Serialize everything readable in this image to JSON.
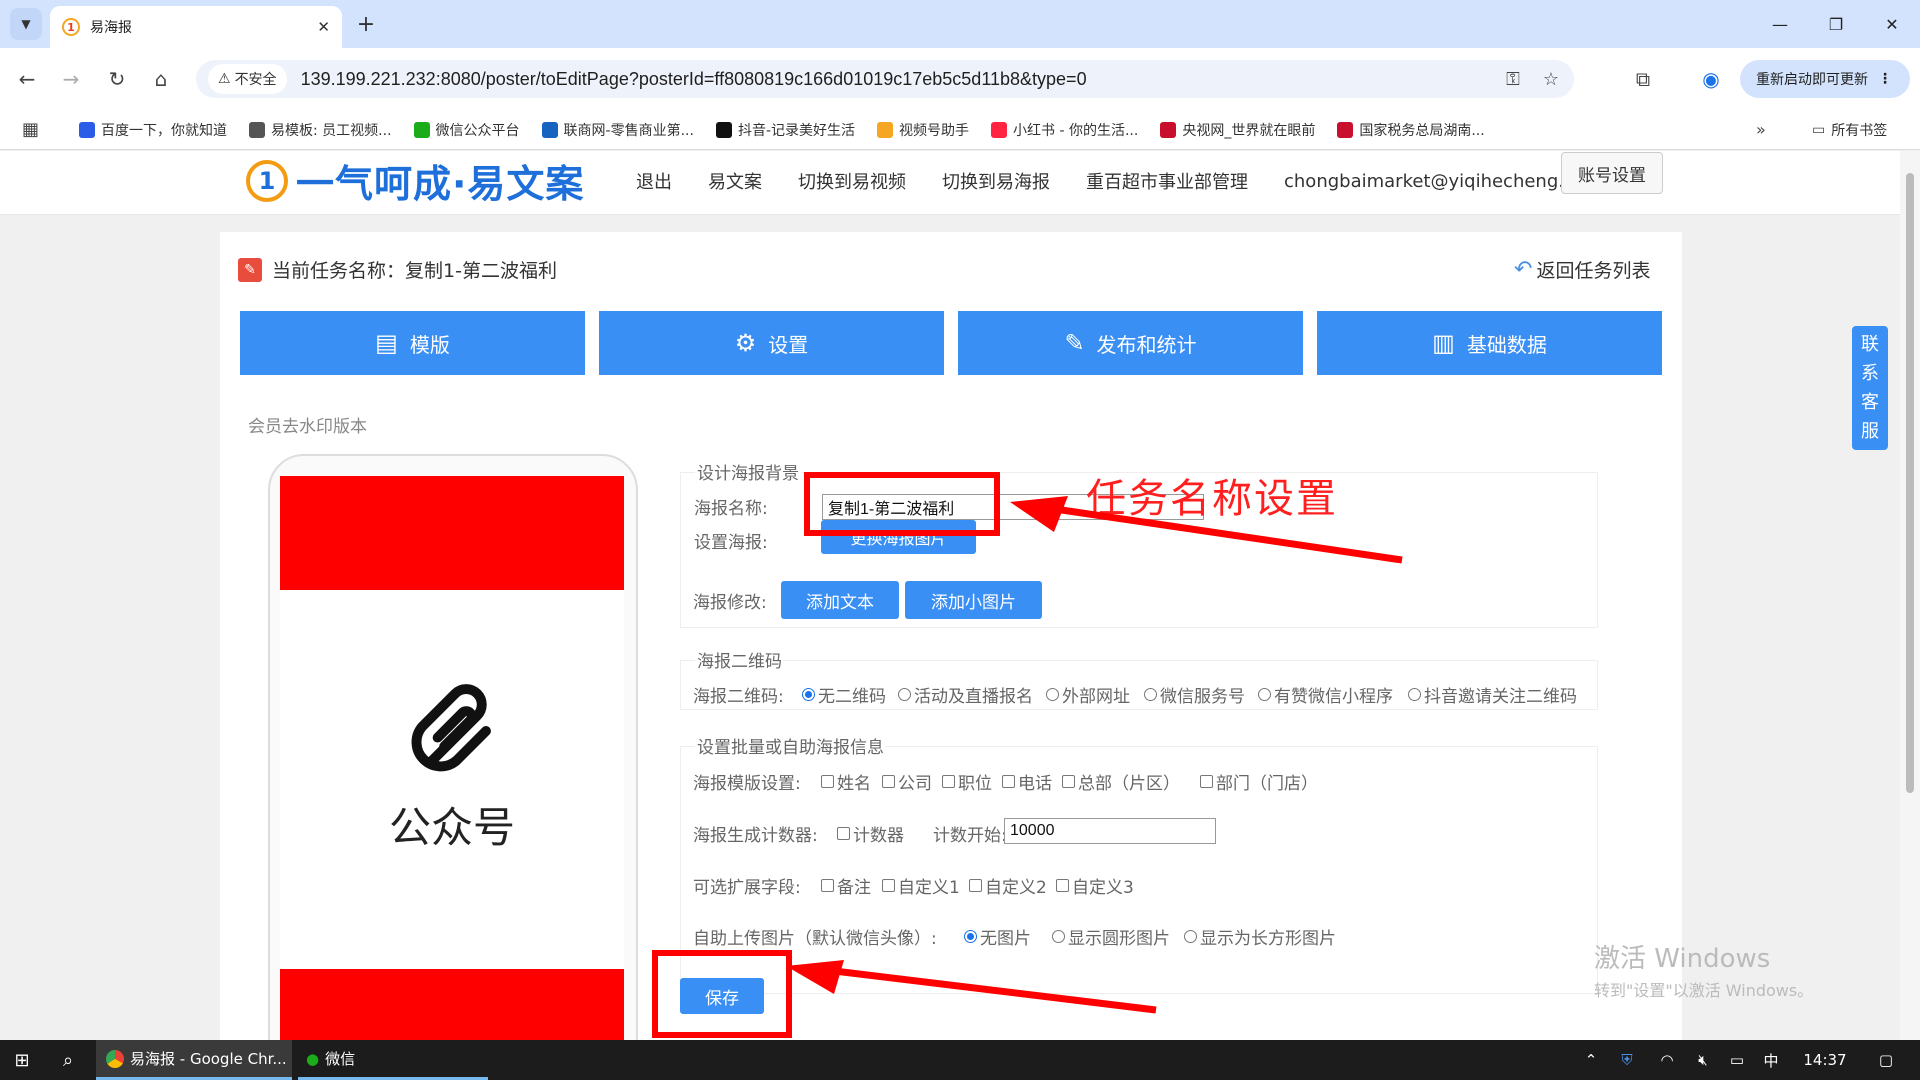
{
  "browser": {
    "tab_title": "易海报",
    "url": "139.199.221.232:8080/poster/toEditPage?posterId=ff8080819c166d01019c17eb5c5d11b8&type=0",
    "insecure_label": "不安全",
    "update_label": "重新启动即可更新",
    "bookmarks": [
      {
        "label": "百度一下，你就知道",
        "color": "#2b5ce8"
      },
      {
        "label": "易模板: 员工视频...",
        "color": "#555555"
      },
      {
        "label": "微信公众平台",
        "color": "#1aad19"
      },
      {
        "label": "联商网-零售商业第...",
        "color": "#1565c0"
      },
      {
        "label": "抖音-记录美好生活",
        "color": "#111111"
      },
      {
        "label": "视频号助手",
        "color": "#f5a623"
      },
      {
        "label": "小红书 - 你的生活...",
        "color": "#ff2442"
      },
      {
        "label": "央视网_世界就在眼前",
        "color": "#c8102e"
      },
      {
        "label": "国家税务总局湖南...",
        "color": "#c8102e"
      }
    ],
    "all_bookmarks_label": "所有书签"
  },
  "site": {
    "logo_text": "一气呵成·易文案",
    "nav": [
      "退出",
      "易文案",
      "切换到易视频",
      "切换到易海报",
      "重百超市事业部管理",
      "chongbaimarket@yiqihecheng.cc"
    ],
    "account_button": "账号设置"
  },
  "page": {
    "task_label": "当前任务名称：复制1-第二波福利",
    "back_label": "返回任务列表",
    "tabs": [
      {
        "label": "模版",
        "icon": "template-icon"
      },
      {
        "label": "设置",
        "icon": "gear-icon"
      },
      {
        "label": "发布和统计",
        "icon": "edit-icon"
      },
      {
        "label": "基础数据",
        "icon": "data-icon"
      }
    ],
    "member_note": "会员去水印版本",
    "preview_text": "公众号"
  },
  "form": {
    "bg_legend": "设计海报背景",
    "name_label": "海报名称:",
    "name_value": "复制1-第二波福利",
    "set_poster_label": "设置海报:",
    "change_image_btn": "更换海报图片",
    "modify_label": "海报修改:",
    "add_text_btn": "添加文本",
    "add_image_btn": "添加小图片",
    "qr_legend": "海报二维码",
    "qr_label": "海报二维码:",
    "qr_options": [
      "无二维码",
      "活动及直播报名",
      "外部网址",
      "微信服务号",
      "有赞微信小程序",
      "抖音邀请关注二维码"
    ],
    "qr_selected": 0,
    "batch_legend": "设置批量或自助海报信息",
    "template_label": "海报模版设置:",
    "template_options": [
      "姓名",
      "公司",
      "职位",
      "电话",
      "总部（片区）",
      "部门（门店）"
    ],
    "counter_label": "海报生成计数器:",
    "counter_option": "计数器",
    "counter_start_label": "计数开始:",
    "counter_start_value": "10000",
    "ext_label": "可选扩展字段:",
    "ext_options": [
      "备注",
      "自定义1",
      "自定义2",
      "自定义3"
    ],
    "upload_label": "自助上传图片（默认微信头像）:",
    "upload_options": [
      "无图片",
      "显示圆形图片",
      "显示为长方形图片"
    ],
    "upload_selected": 0,
    "save_btn": "保存"
  },
  "annotation": {
    "text": "任务名称设置"
  },
  "contact": {
    "chars": [
      "联",
      "系",
      "客",
      "服"
    ]
  },
  "watermark": {
    "line1": "激活 Windows",
    "line2": "转到\"设置\"以激活 Windows。"
  },
  "taskbar": {
    "chrome_label": "易海报 - Google Chr...",
    "wechat_label": "微信",
    "ime": "中",
    "time": "14:37"
  }
}
